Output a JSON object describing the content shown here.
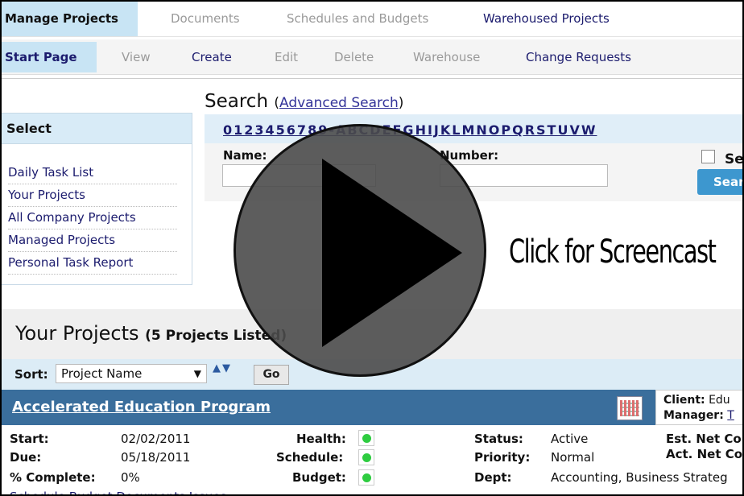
{
  "top_tabs": [
    {
      "label": "Manage Projects"
    },
    {
      "label": "Documents"
    },
    {
      "label": "Schedules and Budgets"
    },
    {
      "label": "Warehoused Projects"
    }
  ],
  "sub_tabs": [
    {
      "label": "Start Page"
    },
    {
      "label": "View"
    },
    {
      "label": "Create"
    },
    {
      "label": "Edit"
    },
    {
      "label": "Delete"
    },
    {
      "label": "Warehouse"
    },
    {
      "label": "Change Requests"
    }
  ],
  "select_panel": {
    "title": "Select",
    "items": [
      "Daily Task List",
      "Your Projects",
      "All Company Projects",
      "Managed Projects",
      "Personal Task Report"
    ]
  },
  "search": {
    "title": "Search",
    "advanced_link": "Advanced Search",
    "paren_open": "(",
    "paren_close": ")",
    "alpha_index": "0123456789-ABCDEFGHIJKLMNOPQRSTUVW",
    "name_label": "Name:",
    "number_label": "Number:",
    "checkbox_label": "Se",
    "button_label": "Sear"
  },
  "your_projects": {
    "title": "Your Projects",
    "count": "(5 Projects Listed)",
    "sort_label": "Sort:",
    "sort_value": "Project Name",
    "go_label": "Go",
    "arrows": "▲▼"
  },
  "project": {
    "name": "Accelerated Education Program",
    "client_label": "Client:",
    "client_value": "Edu",
    "manager_label": "Manager:",
    "manager_value": "T",
    "start_label": "Start:",
    "start_value": "02/02/2011",
    "due_label": "Due:",
    "due_value": "05/18/2011",
    "complete_label": "% Complete:",
    "complete_value": "0%",
    "health_label": "Health:",
    "schedule_label": "Schedule:",
    "budget_label": "Budget:",
    "status_label": "Status:",
    "status_value": "Active",
    "priority_label": "Priority:",
    "priority_value": "Normal",
    "dept_label": "Dept:",
    "dept_value": "Accounting, Business Strateg",
    "est_label": "Est. Net Co",
    "act_label": "Act. Net Co",
    "links": "Schedule   Budget   Documents   Issues"
  },
  "overlay": {
    "cta": "Click for Screencast"
  },
  "colors": {
    "active_tab": "#c8e4f4",
    "header_blue": "#3a6e9c",
    "status_green": "#2ecc40",
    "link": "#1c1c6e"
  }
}
